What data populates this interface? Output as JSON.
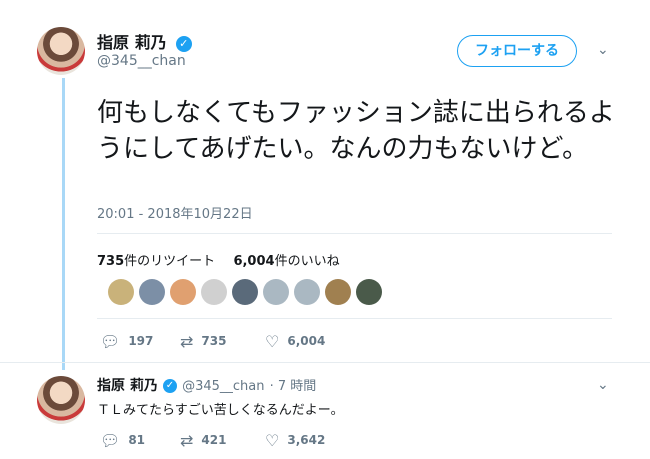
{
  "main_tweet": {
    "author_name": "指原 莉乃",
    "author_handle": "@345__chan",
    "follow_label": "フォローする",
    "text": "何もしなくてもファッション誌に出られるようにしてあげたい。なんの力もないけど。",
    "timestamp": "20:01 - 2018年10月22日",
    "retweet_count": "735",
    "retweet_label": "件のリツイート",
    "like_count": "6,004",
    "like_label": "件のいいね",
    "actions": {
      "reply": "197",
      "retweet": "735",
      "like": "6,004"
    }
  },
  "likers": [
    {
      "icon": "avatar-1",
      "color": "#c9b27a"
    },
    {
      "icon": "avatar-2",
      "color": "#7c8fa6"
    },
    {
      "icon": "avatar-3",
      "color": "#e0a070"
    },
    {
      "icon": "avatar-4",
      "color": "#d0d0d0"
    },
    {
      "icon": "avatar-5",
      "color": "#5a6a7a"
    },
    {
      "icon": "default-avatar",
      "color": "#aab8c2"
    },
    {
      "icon": "default-avatar",
      "color": "#aab8c2"
    },
    {
      "icon": "avatar-8",
      "color": "#a08050"
    },
    {
      "icon": "avatar-9",
      "color": "#4a5a4a"
    }
  ],
  "reply_tweet": {
    "author_name": "指原 莉乃",
    "author_handle": "@345__chan",
    "time": "· 7 時間",
    "text": "ＴＬみてたらすごい苦しくなるんだよー。",
    "actions": {
      "reply": "81",
      "retweet": "421",
      "like": "3,642"
    }
  },
  "colors": {
    "accent": "#1da1f2",
    "muted": "#657786",
    "thread": "#a9d8f7"
  }
}
